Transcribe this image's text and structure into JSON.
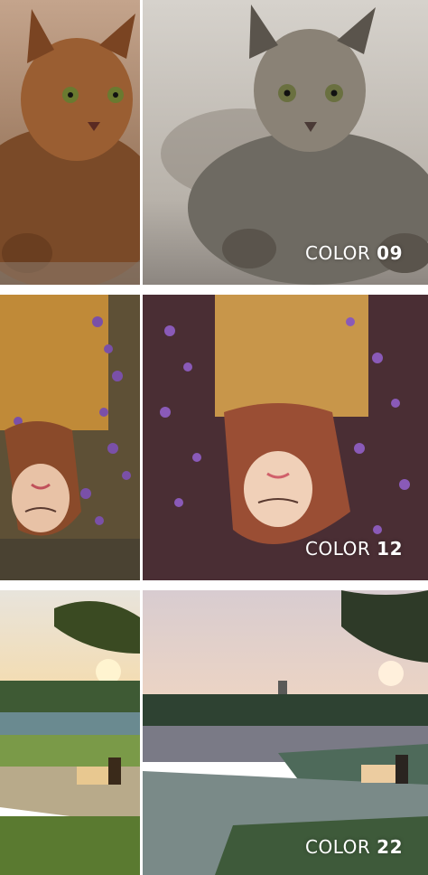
{
  "rows": [
    {
      "subject": "cat",
      "label_prefix": "COLOR",
      "label_number": "09",
      "colors": {
        "before": "#8a5a3a",
        "after": "#9a9890",
        "background": "#d8d2cc"
      }
    },
    {
      "subject": "girl-lavender",
      "label_prefix": "COLOR",
      "label_number": "12",
      "colors": {
        "before": "#6b5a40",
        "after": "#6a3a4a",
        "accent": "#8a5ab8"
      }
    },
    {
      "subject": "landscape-bench",
      "label_prefix": "COLOR",
      "label_number": "22",
      "colors": {
        "before": "#8a9a5a",
        "after": "#6a7a78",
        "sky": "#e8d8cc"
      }
    }
  ]
}
